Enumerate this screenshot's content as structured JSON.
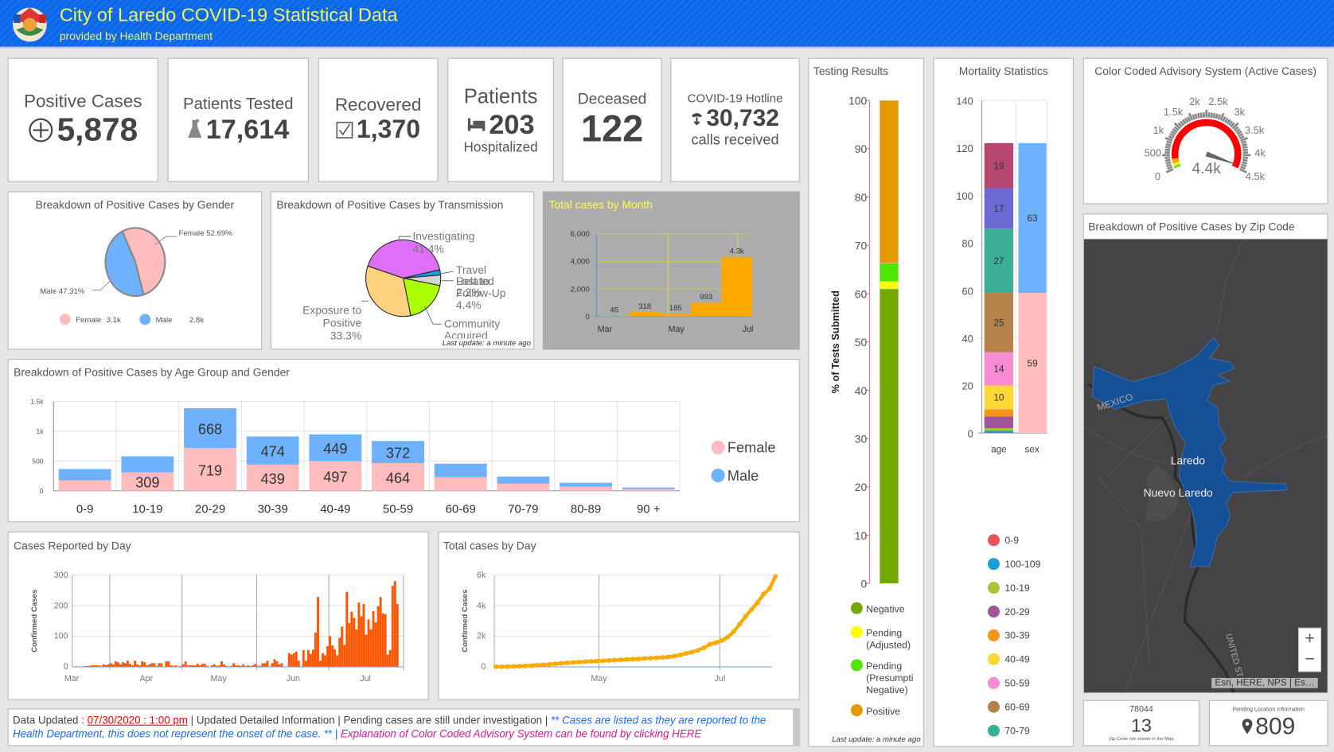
{
  "header": {
    "title": "City of Laredo COVID-19 Statistical Data",
    "subtitle": "provided by Health Department",
    "logo": "city-seal-logo"
  },
  "cards": {
    "positive": {
      "label": "Positive Cases",
      "value": "5,878",
      "icon": "plus-circle-icon"
    },
    "tested": {
      "label": "Patients Tested",
      "value": "17,614",
      "icon": "flask-icon"
    },
    "recovered": {
      "label": "Recovered",
      "value": "1,370",
      "icon": "checkbox-icon"
    },
    "hospitalized": {
      "label": "Patients",
      "value": "203",
      "sublabel": "Hospitalized",
      "icon": "bed-icon"
    },
    "deceased": {
      "label": "Deceased",
      "value": "122"
    },
    "hotline": {
      "label": "COVID-19 Hotline",
      "value": "30,732",
      "sublabel": "calls received",
      "icon": "phone-icon"
    }
  },
  "chart_data": [
    {
      "type": "pie",
      "title": "Breakdown of Positive Cases by Gender",
      "slices": [
        {
          "label": "Female",
          "value": 52.69,
          "callout": "Female 52.69%",
          "legend_value": "3.1k",
          "color": "#ffbcbc"
        },
        {
          "label": "Male",
          "value": 47.31,
          "callout": "Male 47.31%",
          "legend_value": "2.8k",
          "color": "#6eb2ff"
        }
      ]
    },
    {
      "type": "pie",
      "title": "Breakdown of Positive Cases by Transmission",
      "footnote": "Last update: a minute ago",
      "slices": [
        {
          "label": "Investigating",
          "pct": "41.4%",
          "value": 41.4,
          "color": "#dd6ff9"
        },
        {
          "label": "Travel Related",
          "pct": "2.2%",
          "value": 2.2,
          "color": "#1ba1e2"
        },
        {
          "label": "Lost to Follow-Up",
          "pct": "4.4%",
          "value": 4.4,
          "color": "#d4d4d4"
        },
        {
          "label": "Community Acquired",
          "value": 18.7,
          "color": "#aaff00"
        },
        {
          "label": "Exposure to Positive",
          "pct": "33.3%",
          "value": 33.3,
          "color": "#ffd280"
        }
      ]
    },
    {
      "type": "bar",
      "title": "Total cases by Month",
      "categories": [
        "Mar",
        "Apr",
        "May",
        "Jun",
        "Jul"
      ],
      "values": [
        45,
        318,
        185,
        993,
        4337
      ],
      "data_labels": [
        "45",
        "318",
        "185",
        "993",
        "4.3k"
      ],
      "x_tick_labels": [
        "Mar",
        "May",
        "Jul"
      ],
      "y_ticks": [
        "0",
        "2,000",
        "4,000",
        "6,000"
      ],
      "ylim": [
        0,
        6000
      ],
      "color": "#ffa800",
      "background": "#acacac",
      "title_color": "#ffff44"
    },
    {
      "type": "bar",
      "stacked": true,
      "title": "Breakdown of Positive Cases by Age Group and Gender",
      "categories": [
        "0-9",
        "10-19",
        "20-29",
        "30-39",
        "40-49",
        "50-59",
        "60-69",
        "70-79",
        "80-89",
        "90 +"
      ],
      "series": [
        {
          "name": "Female",
          "color": "#ffbcbc",
          "values": [
            175,
            309,
            719,
            439,
            497,
            464,
            230,
            120,
            70,
            30
          ]
        },
        {
          "name": "Male",
          "color": "#6eb2ff",
          "values": [
            190,
            270,
            668,
            474,
            449,
            372,
            225,
            120,
            65,
            25
          ]
        }
      ],
      "y_ticks": [
        "0",
        "500",
        "1k",
        "1.5k"
      ],
      "ylim": [
        0,
        1500
      ],
      "legend": "right"
    },
    {
      "type": "bar",
      "title": "Cases Reported by Day",
      "ylabel": "Confirmed Cases",
      "color": "#ff5500",
      "x_tick_labels": [
        "Mar",
        "Apr",
        "May",
        "Jun",
        "Jul"
      ],
      "y_ticks": [
        "0",
        "100",
        "200",
        "300"
      ],
      "ylim": [
        0,
        300
      ],
      "values_by_month": {
        "Mar": [
          null,
          null,
          null,
          null,
          null,
          null,
          null,
          null,
          null,
          null,
          null,
          null,
          null,
          null,
          null,
          0,
          0,
          2,
          0,
          0,
          3,
          3,
          3,
          5,
          5,
          5,
          5,
          3,
          8,
          6,
          8
        ],
        "Apr": [
          12,
          8,
          18,
          15,
          8,
          15,
          12,
          20,
          10,
          5,
          20,
          8,
          5,
          18,
          15,
          5,
          8,
          12,
          12,
          3,
          12,
          12,
          0,
          18,
          18,
          5,
          3,
          5,
          0,
          3
        ],
        "May": [
          8,
          18,
          5,
          5,
          5,
          5,
          10,
          5,
          10,
          10,
          3,
          0,
          5,
          8,
          3,
          5,
          18,
          8,
          3,
          0,
          3,
          12,
          5,
          5,
          3,
          8,
          3,
          5,
          3,
          5,
          10
        ],
        "Jun": [
          3,
          3,
          12,
          12,
          20,
          0,
          12,
          25,
          18,
          8,
          12,
          0,
          0,
          45,
          40,
          45,
          50,
          20,
          0,
          55,
          20,
          55,
          42,
          56,
          112,
          228,
          20,
          45,
          38,
          68
        ],
        "Jul": [
          100,
          70,
          57,
          38,
          95,
          132,
          72,
          245,
          143,
          180,
          160,
          122,
          210,
          165,
          205,
          105,
          155,
          122,
          182,
          145,
          198,
          228,
          175,
          172,
          40,
          55,
          265,
          280,
          205
        ]
      }
    },
    {
      "type": "scatter",
      "title": "Total cases by Day",
      "ylabel": "Confirmed Cases",
      "color": "#ffaa00",
      "x_tick_labels": [
        "May",
        "Jul"
      ],
      "y_ticks": [
        "0",
        "2k",
        "4k",
        "6k"
      ],
      "ylim": [
        0,
        6000
      ],
      "points": [
        [
          "Mar 10",
          5
        ],
        [
          "Mar 13",
          10
        ],
        [
          "Mar 16",
          15
        ],
        [
          "Mar 19",
          25
        ],
        [
          "Mar 22",
          40
        ],
        [
          "Mar 25",
          60
        ],
        [
          "Mar 28",
          85
        ],
        [
          "Mar 31",
          110
        ],
        [
          "Apr 3",
          140
        ],
        [
          "Apr 6",
          170
        ],
        [
          "Apr 9",
          200
        ],
        [
          "Apr 12",
          230
        ],
        [
          "Apr 15",
          260
        ],
        [
          "Apr 18",
          290
        ],
        [
          "Apr 21",
          315
        ],
        [
          "Apr 24",
          340
        ],
        [
          "Apr 27",
          360
        ],
        [
          "Apr 30",
          380
        ],
        [
          "May 3",
          400
        ],
        [
          "May 6",
          420
        ],
        [
          "May 9",
          440
        ],
        [
          "May 12",
          460
        ],
        [
          "May 15",
          480
        ],
        [
          "May 18",
          500
        ],
        [
          "May 21",
          520
        ],
        [
          "May 24",
          545
        ],
        [
          "May 27",
          570
        ],
        [
          "May 30",
          590
        ],
        [
          "Jun 2",
          620
        ],
        [
          "Jun 5",
          650
        ],
        [
          "Jun 8",
          700
        ],
        [
          "Jun 11",
          780
        ],
        [
          "Jun 14",
          880
        ],
        [
          "Jun 17",
          970
        ],
        [
          "Jun 20",
          1080
        ],
        [
          "Jun 23",
          1250
        ],
        [
          "Jun 26",
          1480
        ],
        [
          "Jun 29",
          1580
        ],
        [
          "Jul 2",
          1720
        ],
        [
          "Jul 5",
          1950
        ],
        [
          "Jul 8",
          2300
        ],
        [
          "Jul 11",
          2800
        ],
        [
          "Jul 14",
          3300
        ],
        [
          "Jul 17",
          3750
        ],
        [
          "Jul 20",
          4200
        ],
        [
          "Jul 23",
          4750
        ],
        [
          "Jul 26",
          5100
        ],
        [
          "Jul 29",
          5900
        ]
      ]
    },
    {
      "type": "bar",
      "stacked": true,
      "title": "Testing Results",
      "ylabel": "% of Tests Submitted",
      "footnote": "Last update: a minute ago",
      "y_ticks": [
        "0",
        "10",
        "20",
        "30",
        "40",
        "50",
        "60",
        "70",
        "80",
        "90",
        "100"
      ],
      "ylim": [
        0,
        100
      ],
      "series": [
        {
          "name": "Negative",
          "value": 61.0,
          "color": "#72a800"
        },
        {
          "name": "Pending (Adjusted)",
          "value": 1.5,
          "color": "#ffff00"
        },
        {
          "name": "Pending (Presumpti Negative)",
          "value": 3.8,
          "color": "#4ce600"
        },
        {
          "name": "Positive",
          "value": 33.7,
          "color": "#e69800"
        }
      ]
    },
    {
      "type": "bar",
      "stacked": true,
      "title": "Mortality Statistics",
      "categories": [
        "age",
        "sex"
      ],
      "y_ticks": [
        "0",
        "20",
        "40",
        "60",
        "80",
        "100",
        "120",
        "140"
      ],
      "ylim": [
        0,
        140
      ],
      "age_series": [
        {
          "name": "0-9",
          "value": 0,
          "color": "#e8545a"
        },
        {
          "name": "100-109",
          "value": 1,
          "color": "#1a9fd6"
        },
        {
          "name": "10-19",
          "value": 1,
          "color": "#a6c43a"
        },
        {
          "name": "20-29",
          "value": 5,
          "color": "#a0549b"
        },
        {
          "name": "30-39",
          "value": 3,
          "color": "#f7941d"
        },
        {
          "name": "40-49",
          "value": 10,
          "label": "10",
          "color": "#fdd835"
        },
        {
          "name": "50-59",
          "value": 14,
          "label": "14",
          "color": "#f78bd4"
        },
        {
          "name": "60-69",
          "value": 25,
          "label": "25",
          "color": "#b5834a"
        },
        {
          "name": "70-79",
          "value": 27,
          "label": "27",
          "color": "#3aaf95"
        },
        {
          "name": "",
          "value": 17,
          "label": "17",
          "color": "#6a6ad2"
        },
        {
          "name": "",
          "value": 19,
          "label": "19",
          "color": "#b5466f"
        }
      ],
      "sex_series": [
        {
          "value": 59,
          "label": "59",
          "color": "#ffbcbc"
        },
        {
          "value": 63,
          "label": "63",
          "color": "#6eb2ff"
        }
      ]
    },
    {
      "type": "gauge",
      "title": "Color Coded Advisory System (Active Cases)",
      "value": 4400,
      "value_label": "4.4k",
      "min": 0,
      "max": 4500,
      "tick_labels": [
        [
          "0",
          0
        ],
        [
          "500",
          500
        ],
        [
          "1k",
          1000
        ],
        [
          "1.5k",
          1500
        ],
        [
          "2k",
          2000
        ],
        [
          "2.5k",
          2500
        ],
        [
          "3k",
          3000
        ],
        [
          "3.5k",
          3500
        ],
        [
          "4k",
          4000
        ],
        [
          "4.5k",
          4500
        ]
      ],
      "bands": [
        {
          "from": 0,
          "to": 80,
          "color": "#66dd22"
        },
        {
          "from": 80,
          "to": 180,
          "color": "#ffee22"
        },
        {
          "from": 180,
          "to": 320,
          "color": "#ffa500"
        },
        {
          "from": 320,
          "to": 4500,
          "color": "#ff0000"
        }
      ]
    }
  ],
  "map": {
    "title": "Breakdown of Positive Cases by Zip Code",
    "labels": {
      "laredo": "Laredo",
      "nuevo": "Nuevo Laredo",
      "mexico": "MEXICO",
      "us": "UNITED ST"
    },
    "zoom_in": "+",
    "zoom_out": "−",
    "attribution": "Esri, HERE, NPS | Es…"
  },
  "zip_card": {
    "zip": "78044",
    "value": "13",
    "note": "Zip Code not shown in the Map"
  },
  "pending_card": {
    "label": "Pending Location Information",
    "value": "809",
    "icon": "map-pin-icon"
  },
  "footer": {
    "prefix": "Data Updated : ",
    "date_link": "07/30/2020 : 1:00 pm",
    "text1": " | Updated Detailed Information | Pending cases are still under investigation | ",
    "note_blue": "** Cases are listed as they are reported to the Health Department, this does not represent the onset of the case. ** ",
    "sep": "| ",
    "note_pink": "Explanation of Color Coded Advisory System can be found by clicking HERE"
  }
}
